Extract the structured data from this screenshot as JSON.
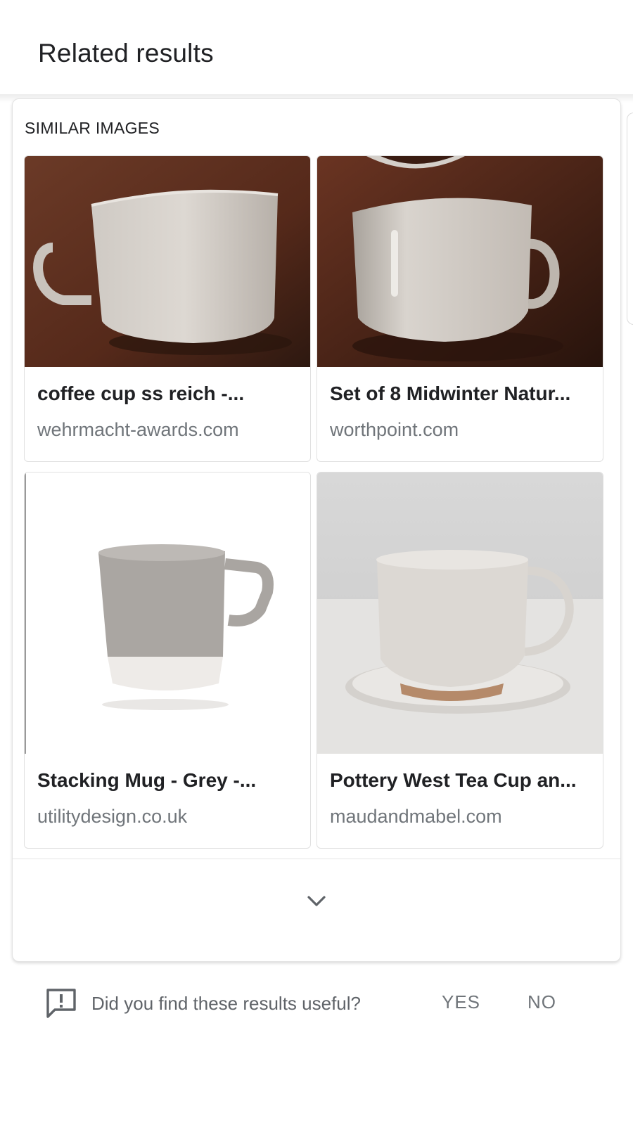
{
  "header": {
    "title": "Related results"
  },
  "similar_images": {
    "section_label": "SIMILAR IMAGES",
    "results": [
      {
        "title": "coffee cup ss reich -...",
        "source": "wehrmacht-awards.com",
        "icon": "white-cup-on-brown-image"
      },
      {
        "title": "Set of 8 Midwinter Natur...",
        "source": "worthpoint.com",
        "icon": "white-cup-on-brown-image"
      },
      {
        "title": "Stacking Mug - Grey -...",
        "source": "utilitydesign.co.uk",
        "icon": "grey-mug-image"
      },
      {
        "title": "Pottery West Tea Cup an...",
        "source": "maudandmabel.com",
        "icon": "cup-and-saucer-image"
      }
    ],
    "expand_icon": "chevron-down-icon"
  },
  "feedback": {
    "icon": "feedback-icon",
    "question": "Did you find these results useful?",
    "yes_label": "YES",
    "no_label": "NO"
  },
  "colors": {
    "text_primary": "#202124",
    "text_secondary": "#70757a",
    "photo_background_brown": "#5a2e1e"
  }
}
